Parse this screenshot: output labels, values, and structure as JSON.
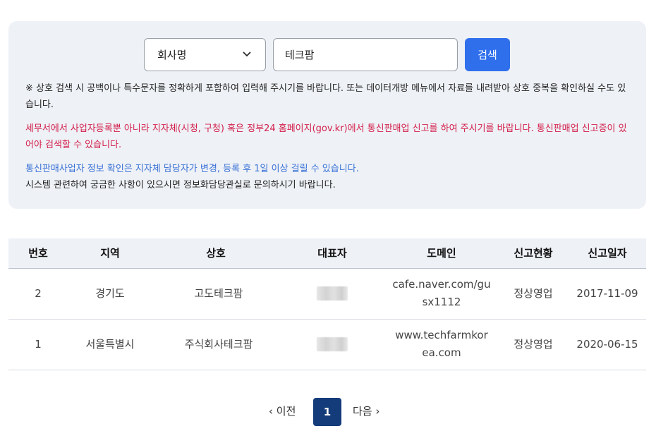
{
  "search": {
    "select_value": "회사명",
    "input_value": "테크팜",
    "button_label": "검색",
    "chevron_icon": "chevron-down-icon"
  },
  "notices": {
    "general": "※ 상호 검색 시 공백이나 특수문자를 정확하게 포함하여 입력해 주시기를 바랍니다. 또는 데이터개방 메뉴에서 자료를 내려받아 상호 중복을 확인하실 수도 있습니다.",
    "warning": "세무서에서 사업자등록뿐 아니라 지자체(시청, 구청) 혹은 정부24 홈페이지(gov.kr)에서 통신판매업 신고를 하여 주시기를 바랍니다. 통신판매업 신고증이 있어야 검색할 수 있습니다.",
    "info": "통신판매사업자 정보 확인은 지자체 담당자가 변경, 등록 후 1일 이상 걸릴 수 있습니다.",
    "contact": "시스템 관련하여 궁금한 사항이 있으시면 정보화담당관실로 문의하시기 바랍니다."
  },
  "colors": {
    "panel_bg": "#eef1f6",
    "accent": "#2f6fec",
    "warning_text": "#d4204c",
    "info_text": "#3a72d6",
    "page_active": "#143c7a"
  },
  "table": {
    "headers": [
      "번호",
      "지역",
      "상호",
      "대표자",
      "도메인",
      "신고현황",
      "신고일자"
    ],
    "rows": [
      {
        "number": "2",
        "region": "경기도",
        "company": "고도테크팜",
        "domain_line1": "cafe.naver.com/gu",
        "domain_line2": "sx1112",
        "status": "정상영업",
        "date": "2017-11-09"
      },
      {
        "number": "1",
        "region": "서울특별시",
        "company": "주식회사테크팜",
        "domain_line1": "www.techfarmkor",
        "domain_line2": "ea.com",
        "status": "정상영업",
        "date": "2020-06-15"
      }
    ]
  },
  "pagination": {
    "prev_label": "이전",
    "current_page": "1",
    "next_label": "다음"
  }
}
